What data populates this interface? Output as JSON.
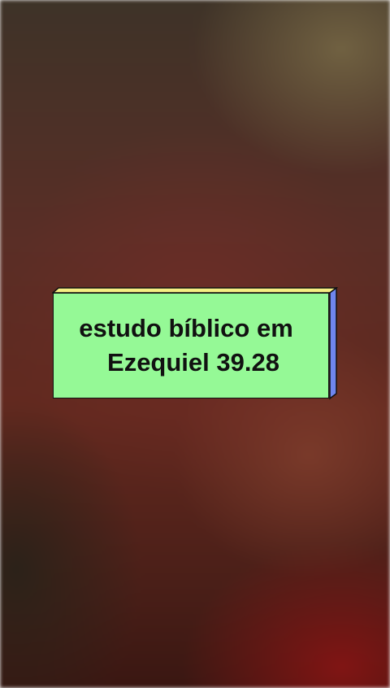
{
  "caption": {
    "line1": "estudo bíblico em",
    "line2": "Ezequiel 39.28"
  },
  "colors": {
    "card_face": "#95f996",
    "card_top_edge": "#f5ef83",
    "card_side_edge": "#6f86ee",
    "text": "#111111"
  }
}
